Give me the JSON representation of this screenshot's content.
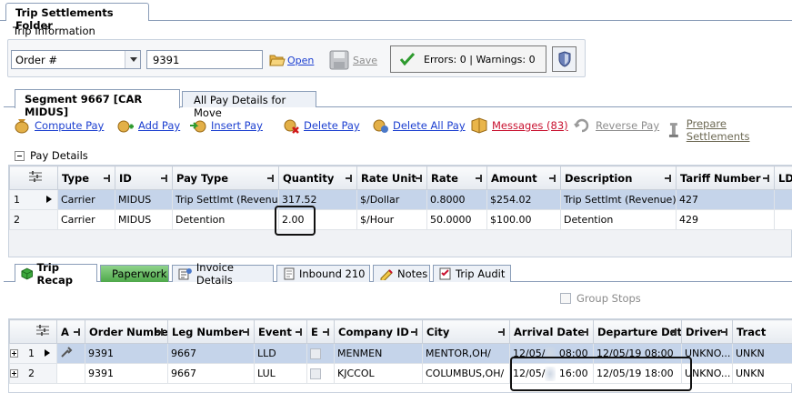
{
  "window": {
    "folder_tab": "Trip Settlements Folder"
  },
  "trip_info": {
    "group_title": "Trip Information",
    "selector_value": "Order #",
    "order_value": "9391",
    "open_label": "Open",
    "save_label": "Save",
    "status_text": "Errors: 0 | Warnings: 0"
  },
  "segment_tabs": [
    {
      "label": "Segment 9667 [CAR MIDUS]",
      "active": true
    },
    {
      "label": "All Pay Details for Move",
      "active": false
    }
  ],
  "toolbar": [
    {
      "label": "Compute Pay",
      "icon": "compute-pay-icon",
      "style": "link"
    },
    {
      "label": "Add Pay",
      "icon": "add-pay-icon",
      "style": "link"
    },
    {
      "label": "Insert Pay",
      "icon": "insert-pay-icon",
      "style": "link"
    },
    {
      "label": "Delete Pay",
      "icon": "delete-pay-icon",
      "style": "link"
    },
    {
      "label": "Delete All Pay",
      "icon": "delete-all-pay-icon",
      "style": "link"
    },
    {
      "label": "Messages (83)",
      "icon": "messages-icon",
      "style": "alert"
    },
    {
      "label": "Reverse Pay",
      "icon": "reverse-pay-icon",
      "style": "disabled"
    },
    {
      "label": "Prepare Settlements",
      "icon": "prepare-settlements-icon",
      "style": "disabled"
    }
  ],
  "pay_details": {
    "label": "Pay Details",
    "columns": [
      "Type",
      "ID",
      "Pay Type",
      "Quantity",
      "Rate Unit",
      "Rate",
      "Amount",
      "Description",
      "Tariff Number",
      "LD"
    ],
    "rows": [
      {
        "num": "1",
        "cells": [
          "Carrier",
          "MIDUS",
          "Trip Settlmt (Revenue)",
          "317.52",
          "$/Dollar",
          "0.8000",
          "$254.02",
          "Trip Settlmt (Revenue)",
          "427",
          ""
        ]
      },
      {
        "num": "2",
        "cells": [
          "Carrier",
          "MIDUS",
          "Detention",
          "2.00",
          "$/Hour",
          "50.0000",
          "$100.00",
          "Detention",
          "429",
          ""
        ]
      }
    ]
  },
  "lower_tabs": [
    {
      "label": "Trip Recap",
      "icon": "cube-icon"
    },
    {
      "label": "Paperwork",
      "icon": ""
    },
    {
      "label": "Invoice Details",
      "icon": "invoice-icon"
    },
    {
      "label": "Inbound 210",
      "icon": "inbound-icon"
    },
    {
      "label": "Notes",
      "icon": "notes-icon"
    },
    {
      "label": "Trip Audit",
      "icon": "audit-icon"
    }
  ],
  "group_stops_label": "Group Stops",
  "trip_recap": {
    "columns": [
      "A",
      "Order Number",
      "Leg Number",
      "Event",
      "E",
      "Company ID",
      "City",
      "Arrival Date",
      "Departure Date",
      "Driver",
      "Tract"
    ],
    "rows": [
      {
        "num": "1",
        "cells": [
          "",
          "9391",
          "9667",
          "LLD",
          "",
          "MENMEN",
          "MENTOR,OH/",
          "12/05/",
          "08:00",
          "12/05/19 08:00",
          "UNKNO...",
          "UNKN"
        ]
      },
      {
        "num": "2",
        "cells": [
          "",
          "9391",
          "9667",
          "LUL",
          "",
          "KJCCOL",
          "COLUMBUS,OH/",
          "12/05/",
          "16:00",
          "12/05/19 18:00",
          "UNKNO...",
          "UNKN"
        ]
      }
    ]
  },
  "colors": {
    "link": "#1c3fd0",
    "alert": "#c8102e",
    "selected_row": "#c5d4ea",
    "green_tab": "#4ea84a"
  }
}
